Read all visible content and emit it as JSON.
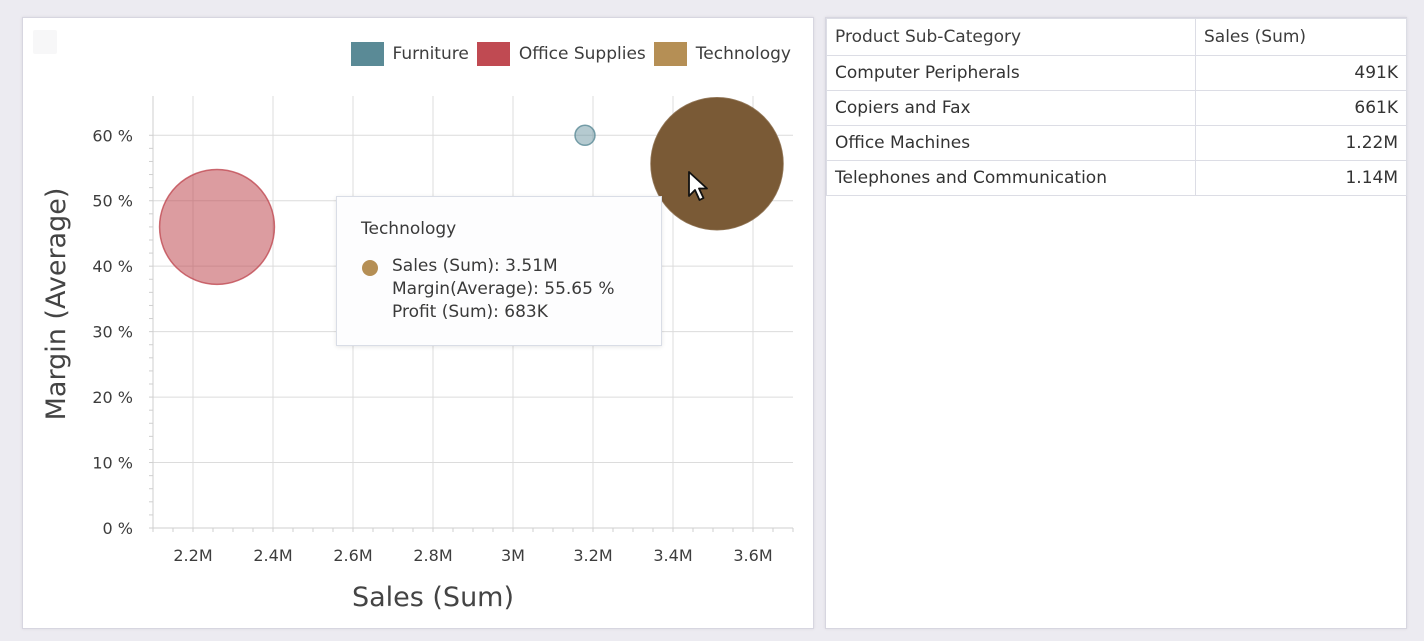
{
  "chart_data": {
    "type": "scatter",
    "subtype": "bubble",
    "xlabel": "Sales (Sum)",
    "ylabel": "Margin (Average)",
    "xlim": [
      2.1,
      3.7
    ],
    "ylim": [
      0,
      0.66
    ],
    "x_ticks": [
      {
        "value": 2.2,
        "label": "2.2M"
      },
      {
        "value": 2.4,
        "label": "2.4M"
      },
      {
        "value": 2.6,
        "label": "2.6M"
      },
      {
        "value": 2.8,
        "label": "2.8M"
      },
      {
        "value": 3.0,
        "label": "3M"
      },
      {
        "value": 3.2,
        "label": "3.2M"
      },
      {
        "value": 3.4,
        "label": "3.4M"
      },
      {
        "value": 3.6,
        "label": "3.6M"
      }
    ],
    "y_ticks": [
      {
        "value": 0.0,
        "label": "0 %"
      },
      {
        "value": 0.1,
        "label": "10 %"
      },
      {
        "value": 0.2,
        "label": "20 %"
      },
      {
        "value": 0.3,
        "label": "30 %"
      },
      {
        "value": 0.4,
        "label": "40 %"
      },
      {
        "value": 0.5,
        "label": "50 %"
      },
      {
        "value": 0.6,
        "label": "60 %"
      }
    ],
    "grid": true,
    "legend_position": "top-right",
    "series": [
      {
        "name": "Furniture",
        "color": "#5a8a96",
        "opacity": 0.45,
        "x": 3.18,
        "y": 0.6,
        "size": 0.0
      },
      {
        "name": "Office Supplies",
        "color": "#c04a52",
        "opacity": 0.55,
        "x": 2.26,
        "y": 0.46,
        "size": 0.49
      },
      {
        "name": "Technology",
        "color": "#7a5a36",
        "opacity": 1.0,
        "x": 3.51,
        "y": 0.5565,
        "size": 0.683
      }
    ]
  },
  "legend": [
    {
      "label": "Furniture",
      "color": "#5a8a96"
    },
    {
      "label": "Office Supplies",
      "color": "#c04a52"
    },
    {
      "label": "Technology",
      "color": "#b58f55"
    }
  ],
  "tooltip": {
    "title": "Technology",
    "dot_color": "#b58f55",
    "sales": "Sales (Sum): 3.51M",
    "margin": "Margin(Average): 55.65 %",
    "profit": "Profit (Sum): 683K"
  },
  "grid": {
    "headers": [
      "Product Sub-Category",
      "Sales (Sum)"
    ],
    "rows": [
      [
        "Computer Peripherals",
        "491K"
      ],
      [
        "Copiers and Fax",
        "661K"
      ],
      [
        "Office Machines",
        "1.22M"
      ],
      [
        "Telephones and Communication",
        "1.14M"
      ]
    ]
  }
}
